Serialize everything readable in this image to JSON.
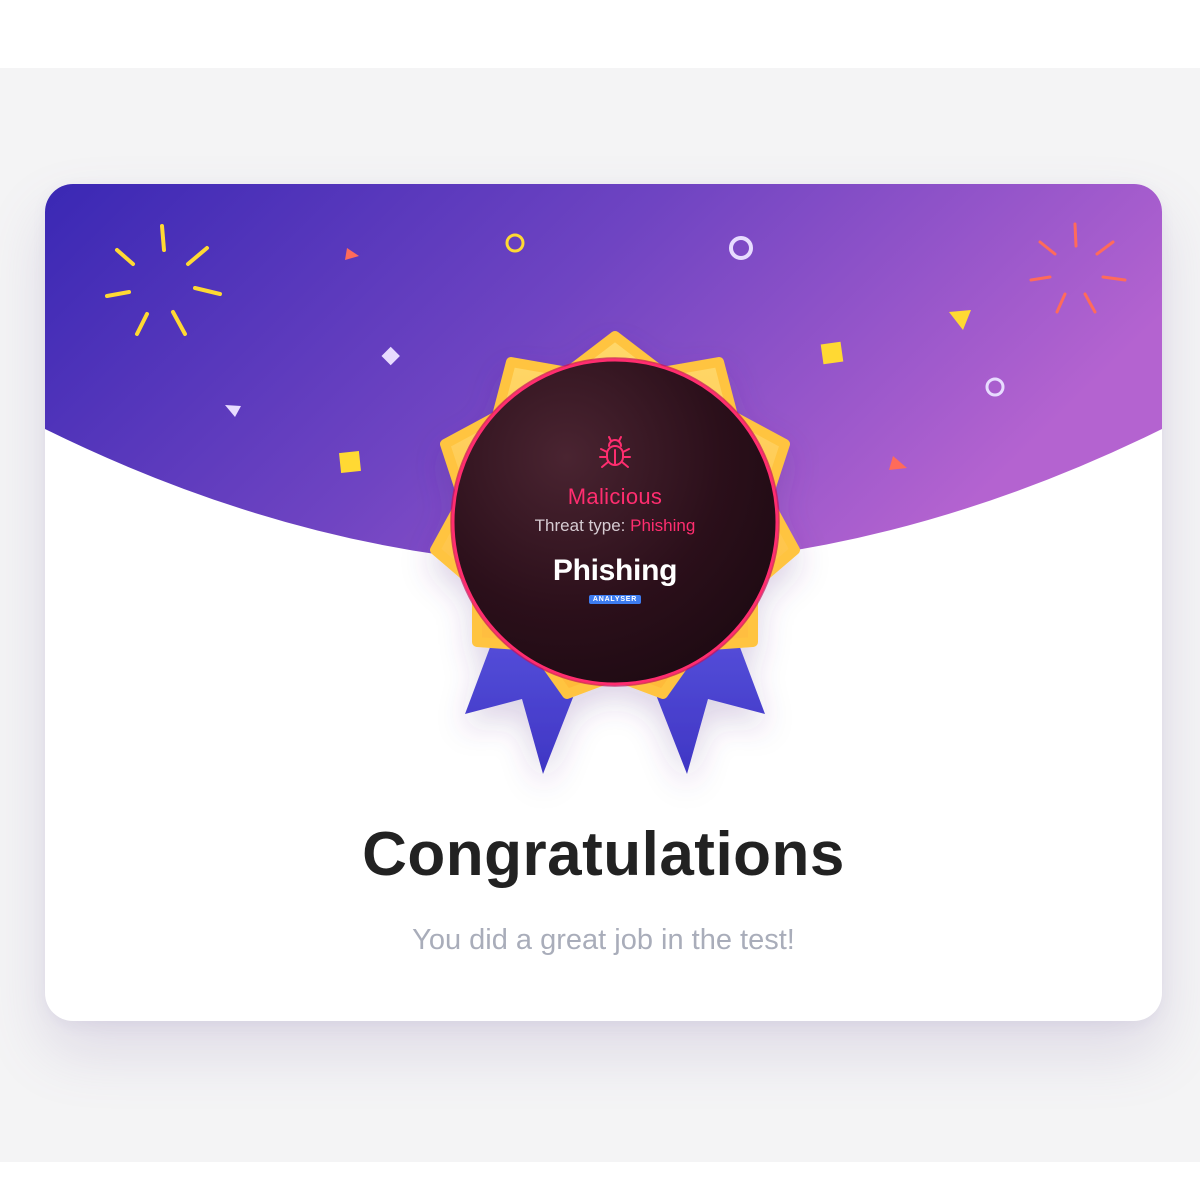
{
  "badge": {
    "icon": "bug-icon",
    "verdict": "Malicious",
    "threat_label": "Threat type:",
    "threat_value": "Phishing",
    "product_name": "Phishing",
    "product_tag": "ANALYSER"
  },
  "message": {
    "title": "Congratulations",
    "subtitle": "You did a great job in the test!"
  },
  "colors": {
    "header_gradient_start": "#3a28b4",
    "header_gradient_end": "#b463d0",
    "badge_gold": "#ffc948",
    "ribbon_blue": "#4b44d2",
    "accent_red": "#ff2d6f",
    "confetti_yellow": "#ffd933",
    "confetti_coral": "#ff6b5a"
  }
}
